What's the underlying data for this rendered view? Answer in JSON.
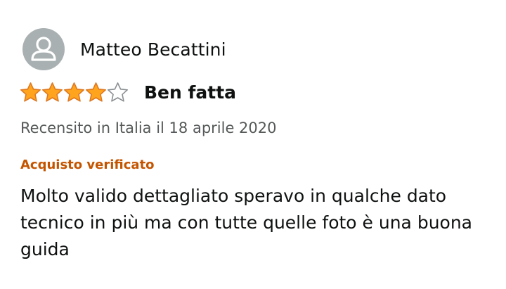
{
  "review": {
    "author_name": "Matteo Becattini",
    "rating": 4,
    "rating_max": 5,
    "title": "Ben fatta",
    "meta": "Recensito in Italia il 18 aprile 2020",
    "badge": "Acquisto verificato",
    "body": "Molto valido dettagliato speravo in qualche dato tecnico in più ma con tutte quelle foto è una buona guida"
  },
  "colors": {
    "star_fill": "#ffa41c",
    "star_outline": "#de7921",
    "badge": "#c45500",
    "avatar_bg": "#a9b0b2",
    "meta_text": "#565959"
  },
  "icons": {
    "avatar": "person-icon",
    "star_full": "star-full-icon",
    "star_empty": "star-empty-icon"
  }
}
